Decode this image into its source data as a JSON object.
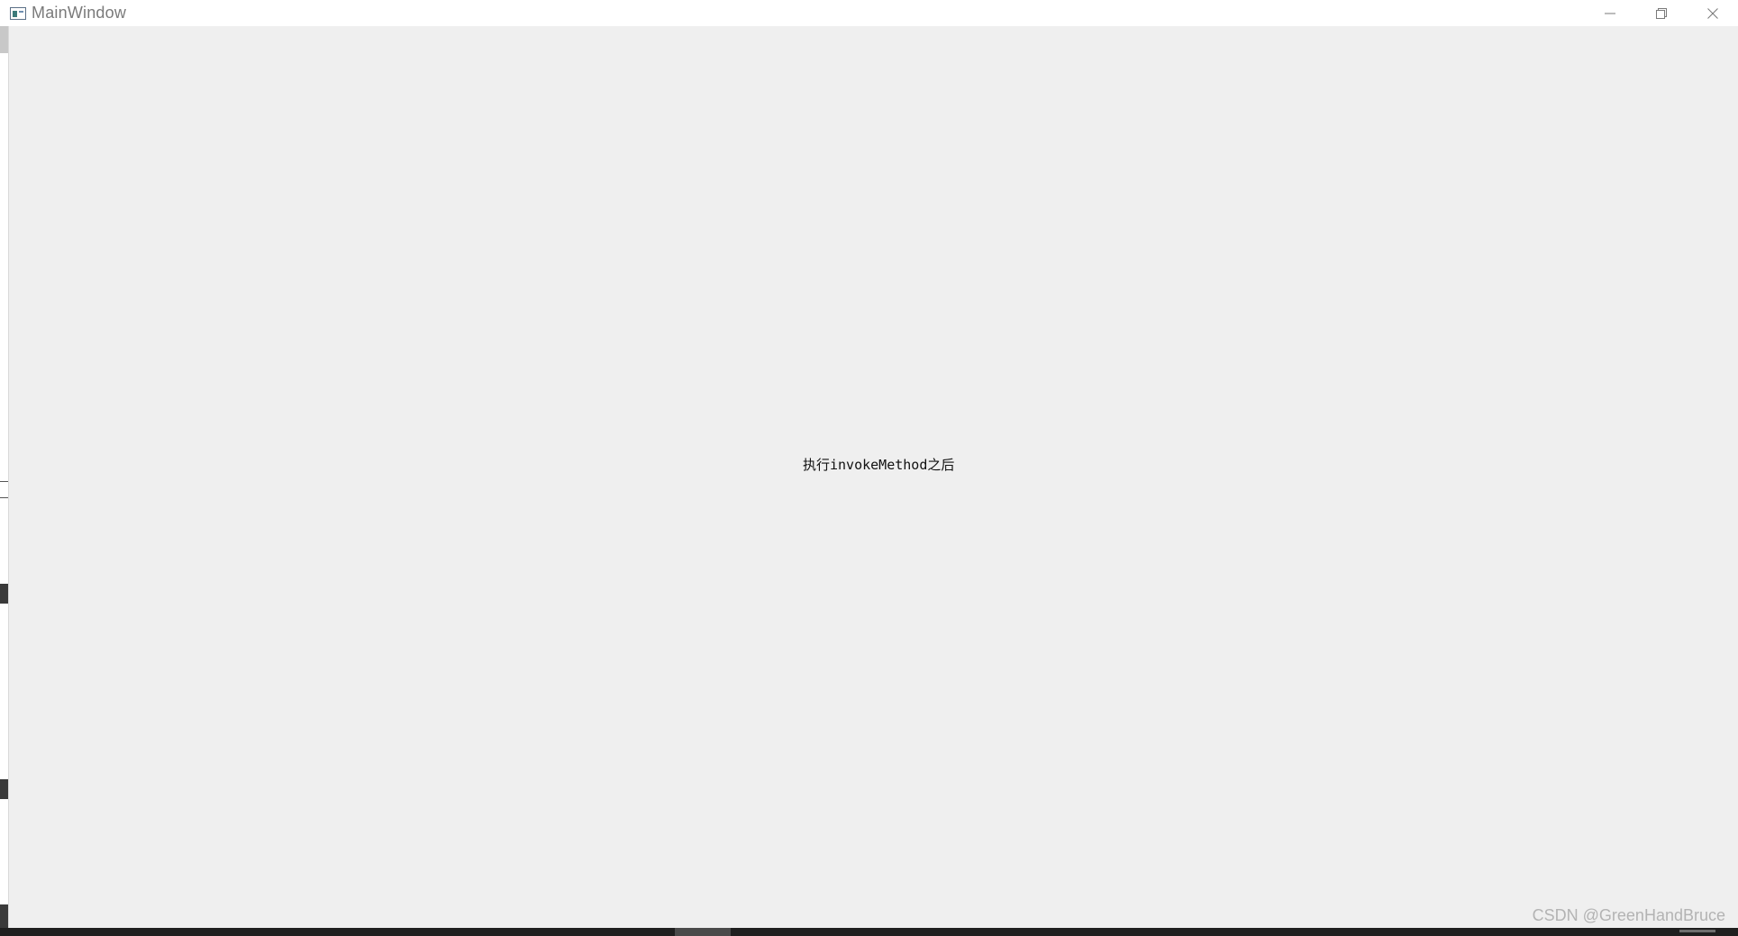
{
  "window": {
    "title": "MainWindow",
    "icon": "app-window-icon"
  },
  "controls": {
    "minimize_icon": "minimize-icon",
    "restore_icon": "restore-icon",
    "close_icon": "close-icon"
  },
  "content": {
    "label": "执行invokeMethod之后"
  },
  "watermark": {
    "text": "CSDN @GreenHandBruce"
  },
  "colors": {
    "titlebar_bg": "#ffffff",
    "client_bg": "#efefef",
    "title_text": "#7a7a7a",
    "label_text": "#111111"
  }
}
